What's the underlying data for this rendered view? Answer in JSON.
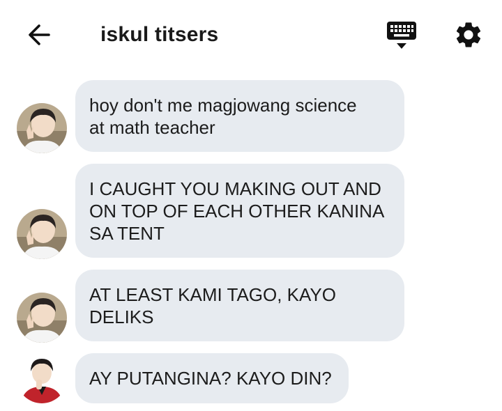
{
  "header": {
    "title": "iskul titsers",
    "back_icon": "arrow-left-icon",
    "keyboard_icon": "keyboard-icon",
    "settings_icon": "gear-icon"
  },
  "colors": {
    "bubble": "#e7ebf0",
    "text": "#1c1c1c",
    "background": "#ffffff"
  },
  "messages": [
    {
      "sender": "user-a",
      "text": "hoy don't me magjowang science\nat math teacher"
    },
    {
      "sender": "user-a",
      "text": "I CAUGHT YOU MAKING OUT AND\nON TOP OF EACH OTHER KANINA\nSA TENT"
    },
    {
      "sender": "user-a",
      "text": "AT LEAST KAMI TAGO, KAYO\nDELIKS"
    },
    {
      "sender": "user-b",
      "text": "AY PUTANGINA? KAYO DIN?"
    }
  ]
}
